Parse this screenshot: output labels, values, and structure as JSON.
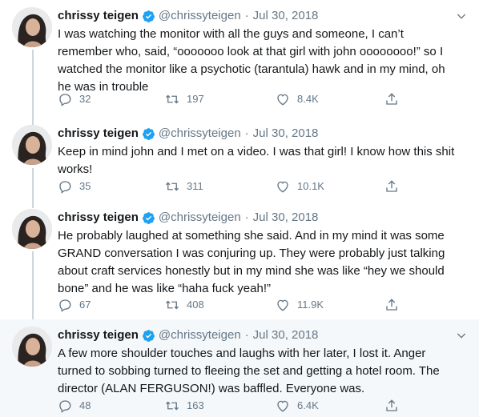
{
  "tweets": [
    {
      "name": "chrissy teigen",
      "handle": "@chrissyteigen",
      "separator": "·",
      "date": "Jul 30, 2018",
      "text": "I was watching the monitor with all the guys and someone, I can’t remember who, said, “ooooooo look at that girl with john oooooooo!” so I watched the monitor like a psychotic (tarantula) hawk and in my mind, oh he was in trouble",
      "replies": "32",
      "retweets": "197",
      "likes": "8.4K"
    },
    {
      "name": "chrissy teigen",
      "handle": "@chrissyteigen",
      "separator": "·",
      "date": "Jul 30, 2018",
      "text": "Keep in mind john and I met on a video. I was that girl! I know how this shit works!",
      "replies": "35",
      "retweets": "311",
      "likes": "10.1K"
    },
    {
      "name": "chrissy teigen",
      "handle": "@chrissyteigen",
      "separator": "·",
      "date": "Jul 30, 2018",
      "text": "He probably laughed at something she said. And in my mind it was some GRAND conversation I was conjuring up. They were probably just talking about craft services honestly but in my mind she was like “hey we should bone” and he was like “haha fuck yeah!”",
      "replies": "67",
      "retweets": "408",
      "likes": "11.9K"
    },
    {
      "name": "chrissy teigen",
      "handle": "@chrissyteigen",
      "separator": "·",
      "date": "Jul 30, 2018",
      "text": "A few more shoulder touches and laughs with her later, I lost it. Anger turned to sobbing turned to fleeing the set and getting a hotel room. The director (ALAN FERGUSON!) was baffled. Everyone was.",
      "replies": "48",
      "retweets": "163",
      "likes": "6.4K"
    }
  ],
  "colors": {
    "text": "#14171a",
    "muted": "#657786",
    "verified": "#1da1f2",
    "thread_line": "#ccd6dd",
    "highlight_bg": "#f5f8fa"
  },
  "icons": [
    "avatar",
    "verified-badge-icon",
    "caret-down-icon",
    "reply-icon",
    "retweet-icon",
    "like-icon",
    "share-icon"
  ]
}
